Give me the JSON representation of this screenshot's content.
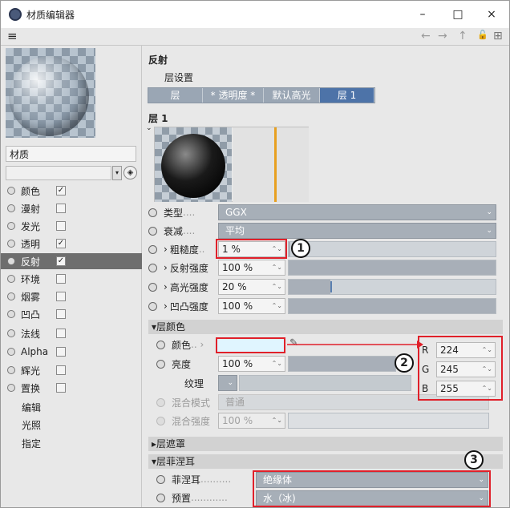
{
  "window": {
    "title": "材质编辑器",
    "min": "–",
    "max": "□",
    "close": "×"
  },
  "menubar": {
    "menu": "≡",
    "back": "←",
    "forward": "→",
    "up": "↑",
    "lock": "🔓",
    "new": "⊞"
  },
  "left": {
    "material_name": "材质",
    "channels": [
      {
        "label": "颜色",
        "checked": "✓"
      },
      {
        "label": "漫射",
        "checked": ""
      },
      {
        "label": "发光",
        "checked": ""
      },
      {
        "label": "透明",
        "checked": "✓"
      },
      {
        "label": "反射",
        "checked": "✓"
      },
      {
        "label": "环境",
        "checked": ""
      },
      {
        "label": "烟雾",
        "checked": ""
      },
      {
        "label": "凹凸",
        "checked": ""
      },
      {
        "label": "法线",
        "checked": ""
      },
      {
        "label": "Alpha",
        "checked": ""
      },
      {
        "label": "辉光",
        "checked": ""
      },
      {
        "label": "置换",
        "checked": ""
      }
    ],
    "extra": [
      "编辑",
      "光照",
      "指定"
    ]
  },
  "right": {
    "section": "反射",
    "layer_settings": "层设置",
    "tabs": [
      "层",
      "* 透明度 *",
      "默认高光",
      "层 1"
    ],
    "layer_title": "层 1",
    "type_label": "类型",
    "type_value": "GGX",
    "atten_label": "衰减",
    "atten_value": "平均",
    "roughness_label": "粗糙度",
    "roughness_value": "1 %",
    "refl_label": "反射强度",
    "refl_value": "100 %",
    "spec_label": "高光强度",
    "spec_value": "20 %",
    "bump_label": "凹凸强度",
    "bump_value": "100 %",
    "layer_color_hdr": "▾层颜色",
    "color_label": "颜色",
    "brightness_label": "亮度",
    "brightness_value": "100 %",
    "texture_label": "纹理",
    "blend_mode_label": "混合模式",
    "blend_mode_value": "普通",
    "blend_strength_label": "混合强度",
    "blend_strength_value": "100 %",
    "mask_hdr": "▸层遮罩",
    "fresnel_hdr": "▾层菲涅耳",
    "fresnel_label": "菲涅耳",
    "fresnel_value": "绝缘体",
    "preset_label": "预置",
    "preset_value": "水（冰)",
    "rgb": {
      "r_label": "R",
      "r": "224",
      "g_label": "G",
      "g": "245",
      "b_label": "B",
      "b": "255"
    },
    "swatch_color": "#e0f5ff",
    "callouts": [
      "1",
      "2",
      "3"
    ]
  }
}
